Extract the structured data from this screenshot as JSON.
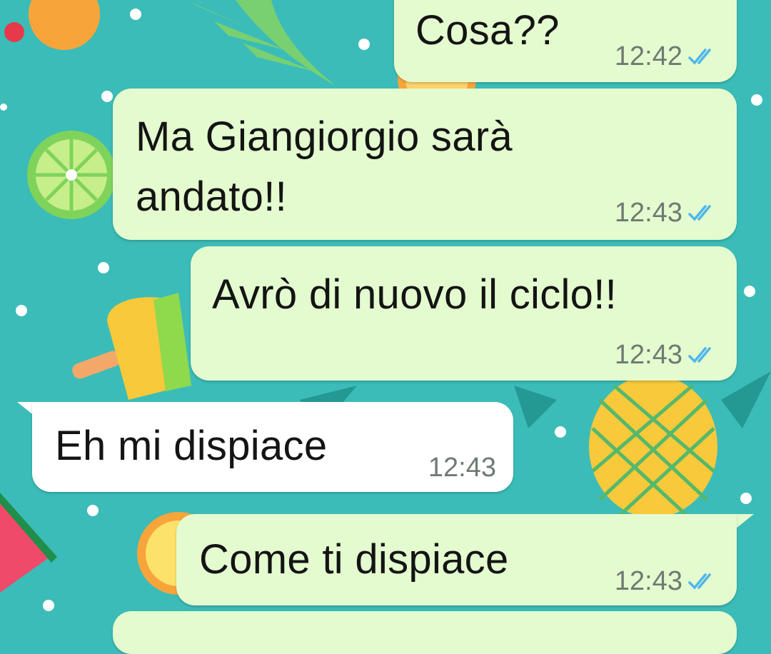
{
  "chat": {
    "messages": [
      {
        "text": "Cosa??",
        "time": "12:42",
        "direction": "outgoing",
        "status": "read"
      },
      {
        "text": "Ma Giangiorgio sarà andato!!",
        "line1": "Ma Giangiorgio sarà",
        "line2": "andato!!",
        "time": "12:43",
        "direction": "outgoing",
        "status": "read"
      },
      {
        "text": "Avrò di nuovo il ciclo!!",
        "time": "12:43",
        "direction": "outgoing",
        "status": "read"
      },
      {
        "text": "Eh mi dispiace",
        "time": "12:43",
        "direction": "incoming"
      },
      {
        "text": "Come ti dispiace",
        "time": "12:43",
        "direction": "outgoing",
        "status": "read"
      }
    ]
  },
  "colors": {
    "wallpaper": "#3bbcb8",
    "outgoing_bubble": "#e4fbcf",
    "incoming_bubble": "#ffffff",
    "read_ticks": "#4fb6ec",
    "timestamp": "#6f7a72"
  },
  "icons": {
    "status": "double-check-icon"
  }
}
